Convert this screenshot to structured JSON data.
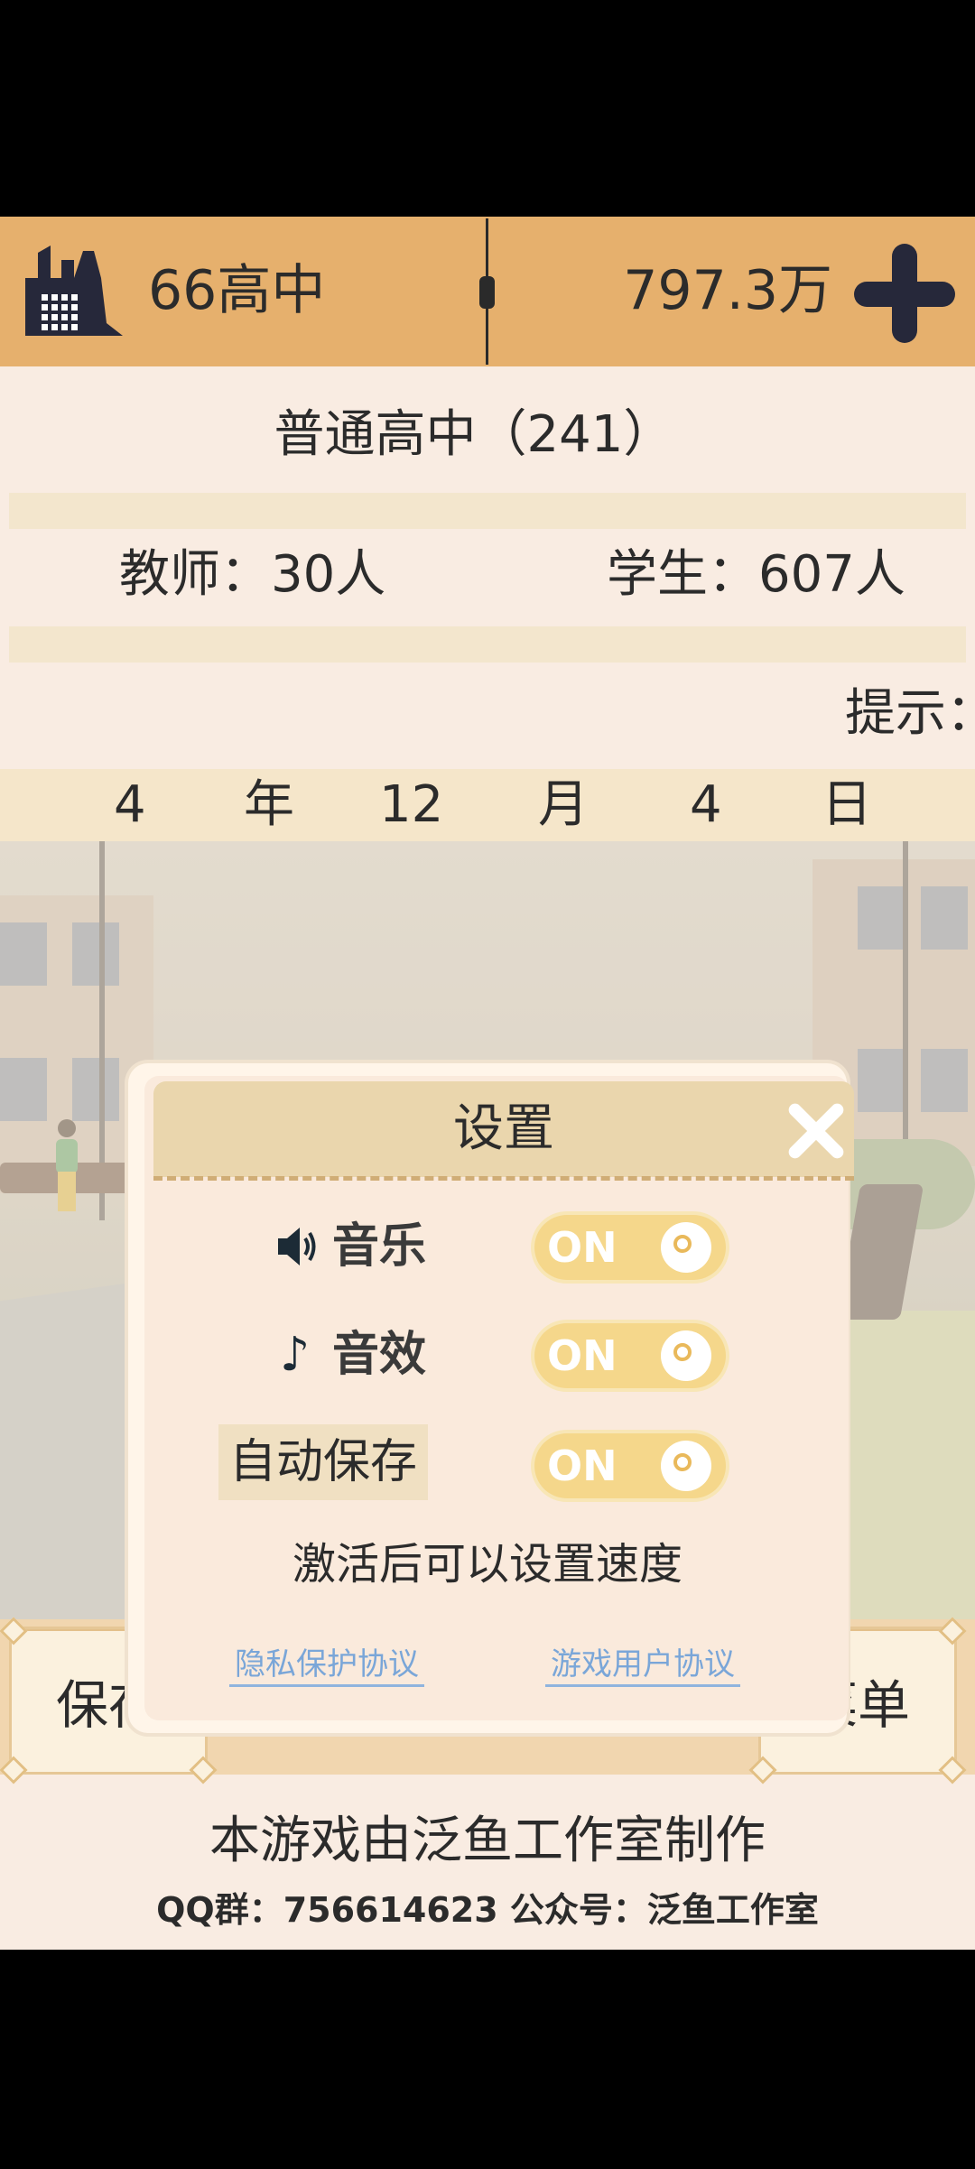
{
  "topbar": {
    "school_name": "66高中",
    "money": "797.3万",
    "school_icon": "factory-building-icon",
    "add_icon": "plus-icon",
    "bar_color": "#e6b06d"
  },
  "info": {
    "school_type": "普通高中（241）",
    "teachers": "教师：30人",
    "students": "学生：607人",
    "hint": "提示："
  },
  "date": {
    "year": "4",
    "year_unit": "年",
    "month": "12",
    "month_unit": "月",
    "day": "4",
    "day_unit": "日"
  },
  "dialog": {
    "title": "设置",
    "close_icon": "close-icon",
    "music_label": "音乐",
    "music_icon": "speaker-icon",
    "music_toggle": "ON",
    "sfx_label": "音效",
    "sfx_icon": "music-note-icon",
    "sfx_toggle": "ON",
    "autosave_label": "自动保存",
    "autosave_toggle": "ON",
    "speed_note": "激活后可以设置速度",
    "privacy_link": "隐私保护协议",
    "user_link": "游戏用户协议",
    "toggle_color": "#f5d78b",
    "link_color": "#7aa6d8"
  },
  "bottom": {
    "save_label": "保存",
    "menu_label": "菜单",
    "credit": "本游戏由泛鱼工作室制作",
    "contact": "QQ群：756614623 公众号：泛鱼工作室"
  }
}
